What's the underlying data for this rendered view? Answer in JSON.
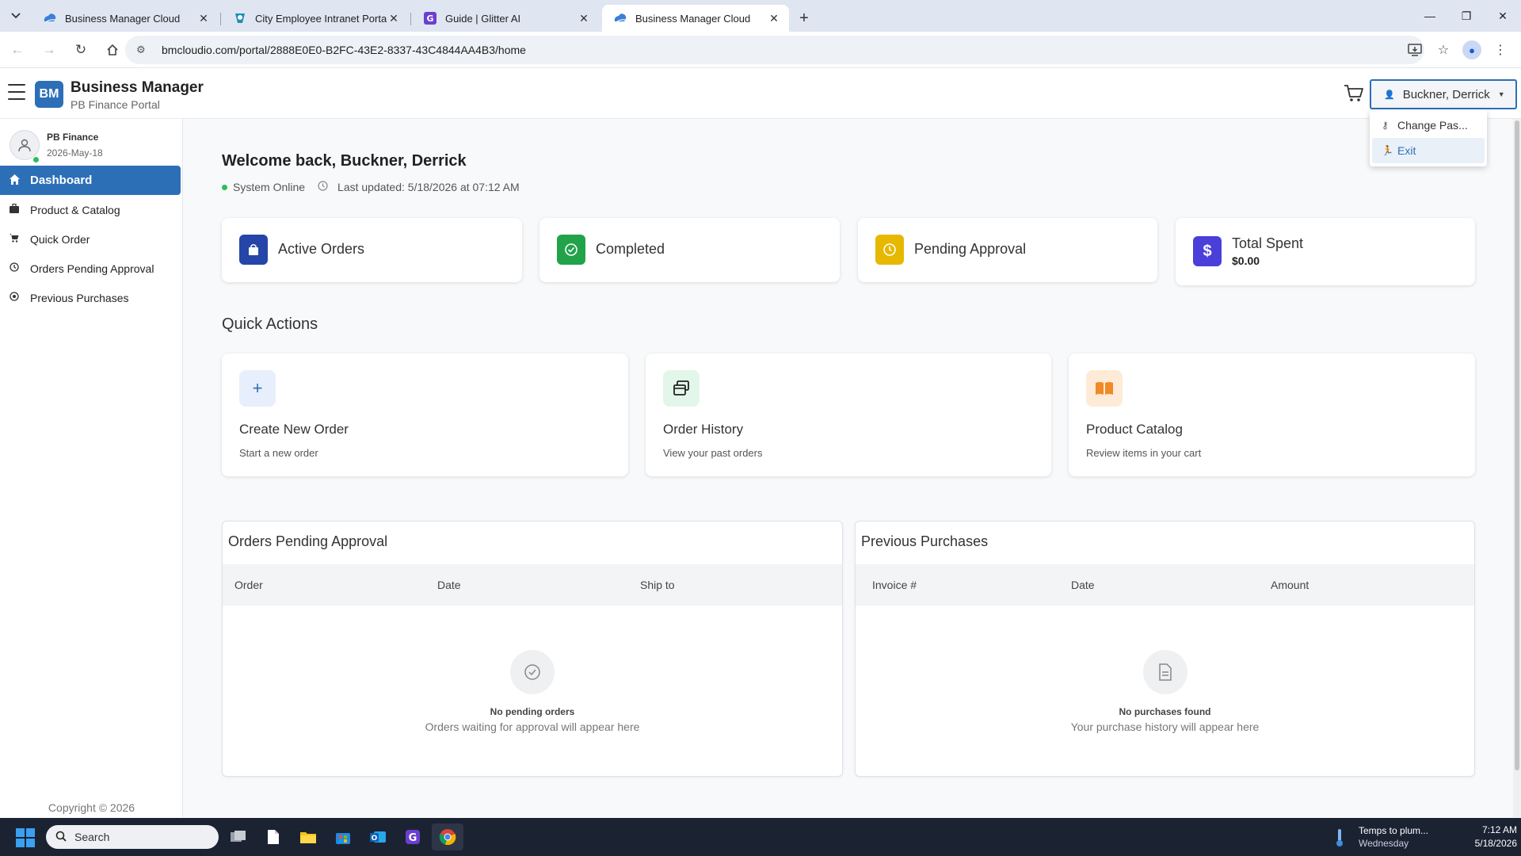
{
  "browser": {
    "tabs": [
      {
        "title": "Business Manager Cloud",
        "active": false
      },
      {
        "title": "City Employee Intranet Portal -",
        "active": false
      },
      {
        "title": "Guide | Glitter AI",
        "active": false
      },
      {
        "title": "Business Manager Cloud",
        "active": true
      }
    ],
    "url": "bmcloudio.com/portal/2888E0E0-B2FC-43E2-8337-43C4844AA4B3/home"
  },
  "header": {
    "logo": "BM",
    "title": "Business Manager",
    "subtitle": "PB Finance Portal",
    "user": "Buckner, Derrick",
    "dropdown": [
      "Change Pas...",
      "Exit"
    ]
  },
  "sidebar": {
    "profile_name": "PB Finance",
    "profile_date": "2026-May-18",
    "items": [
      {
        "label": "Dashboard",
        "icon": "home-icon",
        "active": true
      },
      {
        "label": "Product & Catalog",
        "icon": "briefcase-icon",
        "active": false
      },
      {
        "label": "Quick Order",
        "icon": "cart-icon",
        "active": false
      },
      {
        "label": "Orders Pending Approval",
        "icon": "clock-icon",
        "active": false
      },
      {
        "label": "Previous Purchases",
        "icon": "history-icon",
        "active": false
      }
    ],
    "copyright": "Copyright © 2026"
  },
  "main": {
    "welcome": "Welcome back, Buckner, Derrick",
    "system_status": "System Online",
    "last_updated": "Last updated: 5/18/2026 at 07:12 AM",
    "stats": [
      {
        "label": "Active Orders",
        "color": "#2545a8"
      },
      {
        "label": "Completed",
        "color": "#22a34a"
      },
      {
        "label": "Pending Approval",
        "color": "#e6b800"
      },
      {
        "label": "Total Spent",
        "value": "$0.00",
        "color": "#4a3fd8"
      }
    ],
    "quick_actions_title": "Quick Actions",
    "quick_actions": [
      {
        "title": "Create New Order",
        "desc": "Start a new order"
      },
      {
        "title": "Order History",
        "desc": "View your past orders"
      },
      {
        "title": "Product Catalog",
        "desc": "Review items in your cart"
      }
    ],
    "pending": {
      "title": "Orders Pending Approval",
      "columns": [
        "Order",
        "Date",
        "Ship to"
      ],
      "empty_title": "No pending orders",
      "empty_sub": "Orders waiting for approval will appear here"
    },
    "previous": {
      "title": "Previous Purchases",
      "columns": [
        "Invoice #",
        "Date",
        "Amount"
      ],
      "empty_title": "No purchases found",
      "empty_sub": "Your purchase history will appear here"
    }
  },
  "taskbar": {
    "search": "Search",
    "weather_line1": "Temps to plum...",
    "weather_line2": "Wednesday",
    "time": "7:12 AM",
    "date": "5/18/2026"
  }
}
